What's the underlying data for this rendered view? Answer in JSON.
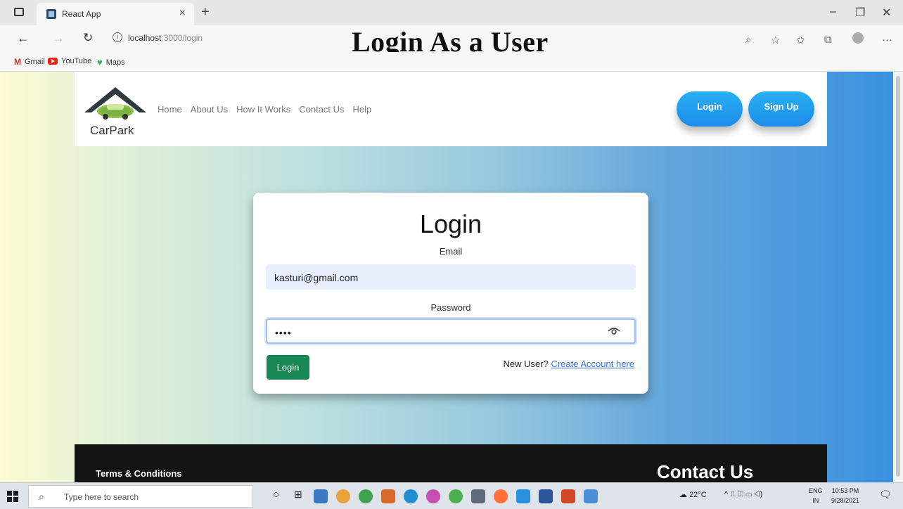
{
  "browser": {
    "tab_title": "React App",
    "tab_close": "×",
    "new_tab": "+",
    "url_host": "localhost",
    "url_rest": ":3000/login",
    "bookmarks": [
      "Gmail",
      "YouTube",
      "Maps"
    ]
  },
  "overlay_title": "Login As a User",
  "navbar": {
    "brand": "CarPark",
    "links": [
      "Home",
      "About Us",
      "How It Works",
      "Contact Us",
      "Help"
    ],
    "login_button": "Login",
    "signup_button": "Sign Up"
  },
  "login_form": {
    "title": "Login",
    "email_label": "Email",
    "email_value": "kasturi@gmail.com",
    "password_label": "Password",
    "password_value": "••••",
    "submit_label": "Login",
    "new_user_text": "New User?",
    "create_account_link": "Create Account here"
  },
  "footer": {
    "terms": "Terms & Conditions",
    "contact_us": "Contact Us"
  },
  "taskbar": {
    "search_placeholder": "Type here to search",
    "weather": "22°C",
    "language": [
      "ENG",
      "IN"
    ],
    "time": "10:53 PM",
    "date": "9/28/2021"
  },
  "colors": {
    "pill_gradient": [
      "#29b0f5",
      "#1e8ce8"
    ],
    "submit_button": "#198754",
    "link": "#3b6fe0",
    "footer": "#141414"
  }
}
